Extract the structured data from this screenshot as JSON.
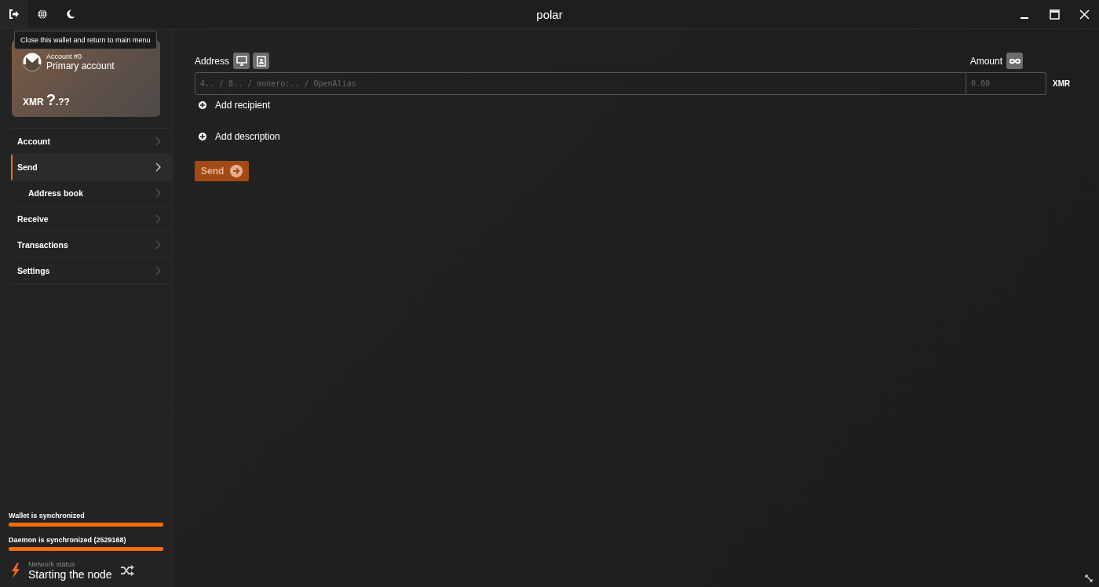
{
  "window": {
    "title": "polar"
  },
  "tooltip": "Close this wallet and return to main menu",
  "account_card": {
    "account_number": "Account #0",
    "account_name": "Primary account",
    "currency": "XMR",
    "balance_integer": "?",
    "balance_fraction": ".??"
  },
  "nav": [
    {
      "label": "Account",
      "selected": false
    },
    {
      "label": "Send",
      "selected": true,
      "children": [
        {
          "label": "Address book",
          "selected": false
        }
      ]
    },
    {
      "label": "Receive",
      "selected": false
    },
    {
      "label": "Transactions",
      "selected": false
    },
    {
      "label": "Settings",
      "selected": false
    }
  ],
  "sync": [
    {
      "label": "Wallet is synchronized",
      "level": 1
    },
    {
      "label": "Daemon is synchronized (2529168)",
      "level": 1
    }
  ],
  "network": {
    "caption": "Network status",
    "status": "Starting the node"
  },
  "form": {
    "address_label": "Address",
    "address_placeholder": "4.. / 8.. / monero:.. / OpenAlias",
    "amount_label": "Amount",
    "amount_placeholder": "0.00",
    "currency": "XMR",
    "add_recipient": "Add recipient",
    "add_description": "Add description",
    "send_button": {
      "label": "Send",
      "disabled": true
    }
  }
}
